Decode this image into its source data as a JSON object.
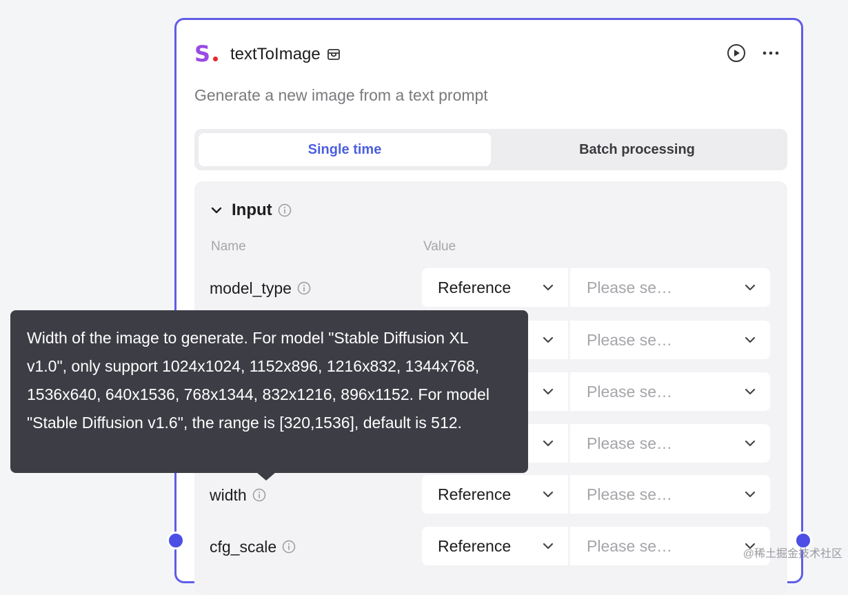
{
  "node": {
    "title": "textToImage",
    "description": "Generate a new image from a text prompt",
    "border_color": "#5f5ce8"
  },
  "tabs": [
    {
      "label": "Single time",
      "active": true
    },
    {
      "label": "Batch processing",
      "active": false
    }
  ],
  "input_section": {
    "title": "Input",
    "col_name": "Name",
    "col_value": "Value",
    "rows": [
      {
        "name": "model_type",
        "ref_label": "Reference",
        "placeholder": "Please se…"
      },
      {
        "name": "",
        "ref_label": "",
        "placeholder": "Please se…"
      },
      {
        "name": "",
        "ref_label": "",
        "placeholder": "Please se…"
      },
      {
        "name": "",
        "ref_label": "",
        "placeholder": "Please se…"
      },
      {
        "name": "width",
        "ref_label": "Reference",
        "placeholder": "Please se…"
      },
      {
        "name": "cfg_scale",
        "ref_label": "Reference",
        "placeholder": "Please se…"
      }
    ]
  },
  "tooltip": {
    "text": "Width of the image to generate. For model \"Stable Diffusion XL v1.0\", only support 1024x1024, 1152x896, 1216x832, 1344x768, 1536x640, 640x1536, 768x1344, 832x1216, 896x1152. For model \"Stable Diffusion v1.6\", the range is [320,1536], default is 512."
  },
  "watermark": "@稀土掘金技术社区",
  "icons": {
    "logo": "brand-s-logo",
    "store": "store-icon",
    "run": "play-circle-icon",
    "more": "more-dots-icon",
    "collapse": "chevron-down-icon",
    "info": "info-circle-icon",
    "dropdown": "chevron-down-icon"
  },
  "colors": {
    "accent": "#4c5fe0",
    "handle": "#4c4ee6",
    "logo_purple": "#9a4be3",
    "logo_dot": "#e6262f",
    "tooltip_bg": "#3d3d45"
  }
}
